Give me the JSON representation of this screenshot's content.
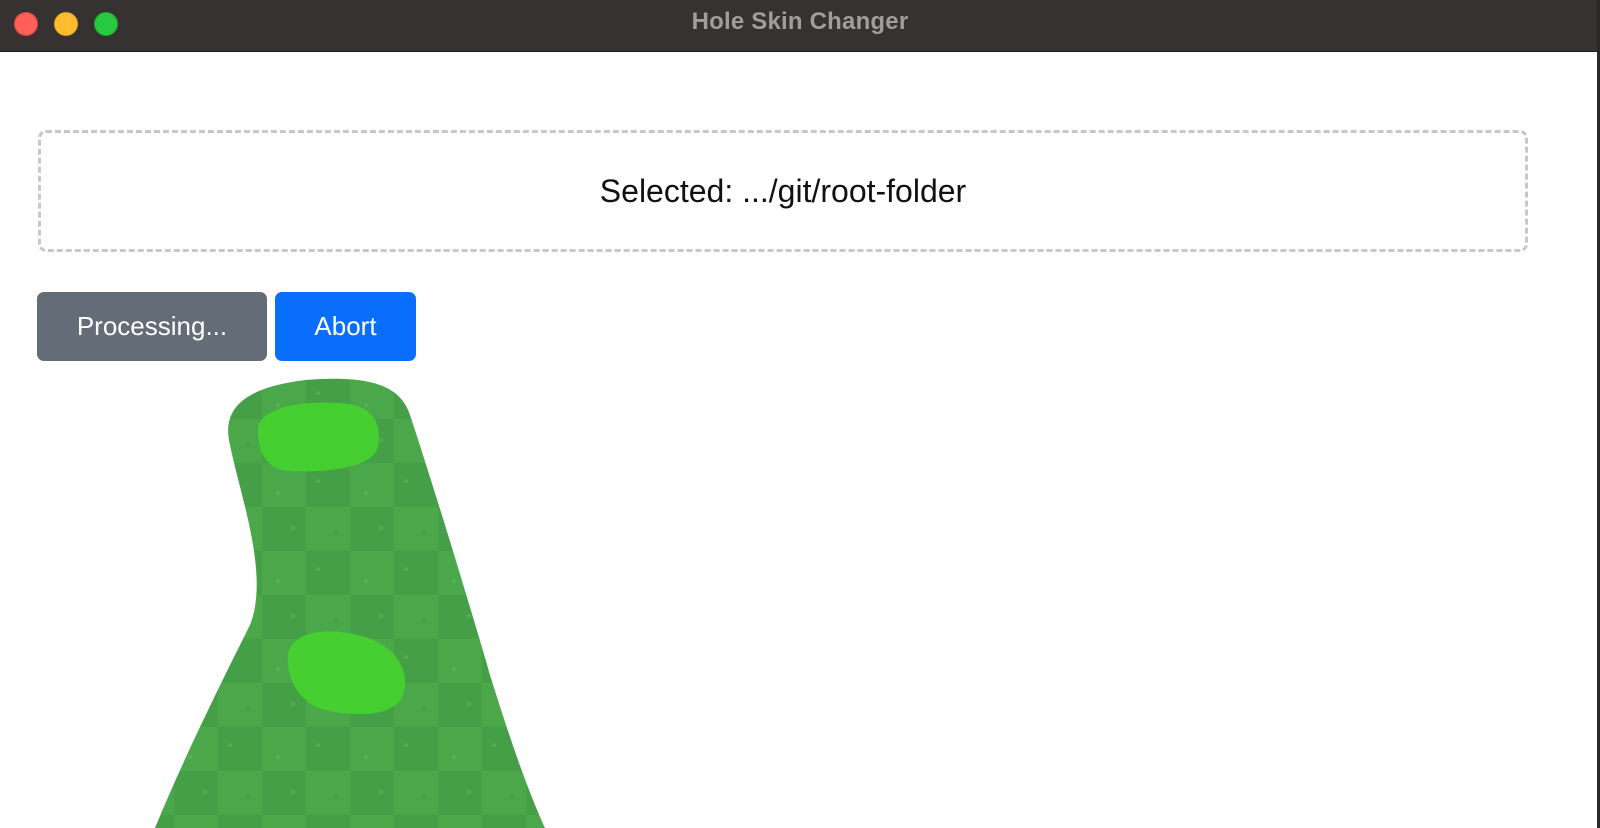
{
  "window": {
    "title": "Hole Skin Changer"
  },
  "dropzone": {
    "text": "Selected: .../git/root-folder"
  },
  "actions": {
    "processing_label": "Processing...",
    "abort_label": "Abort"
  },
  "colors": {
    "processing_button": "#646c77",
    "abort_button": "#0a6efd",
    "fairway_green": "#4caf50",
    "green_patch": "#45d12f"
  },
  "icons": {
    "close": "close-icon",
    "minimize": "minimize-icon",
    "zoom": "zoom-icon"
  }
}
